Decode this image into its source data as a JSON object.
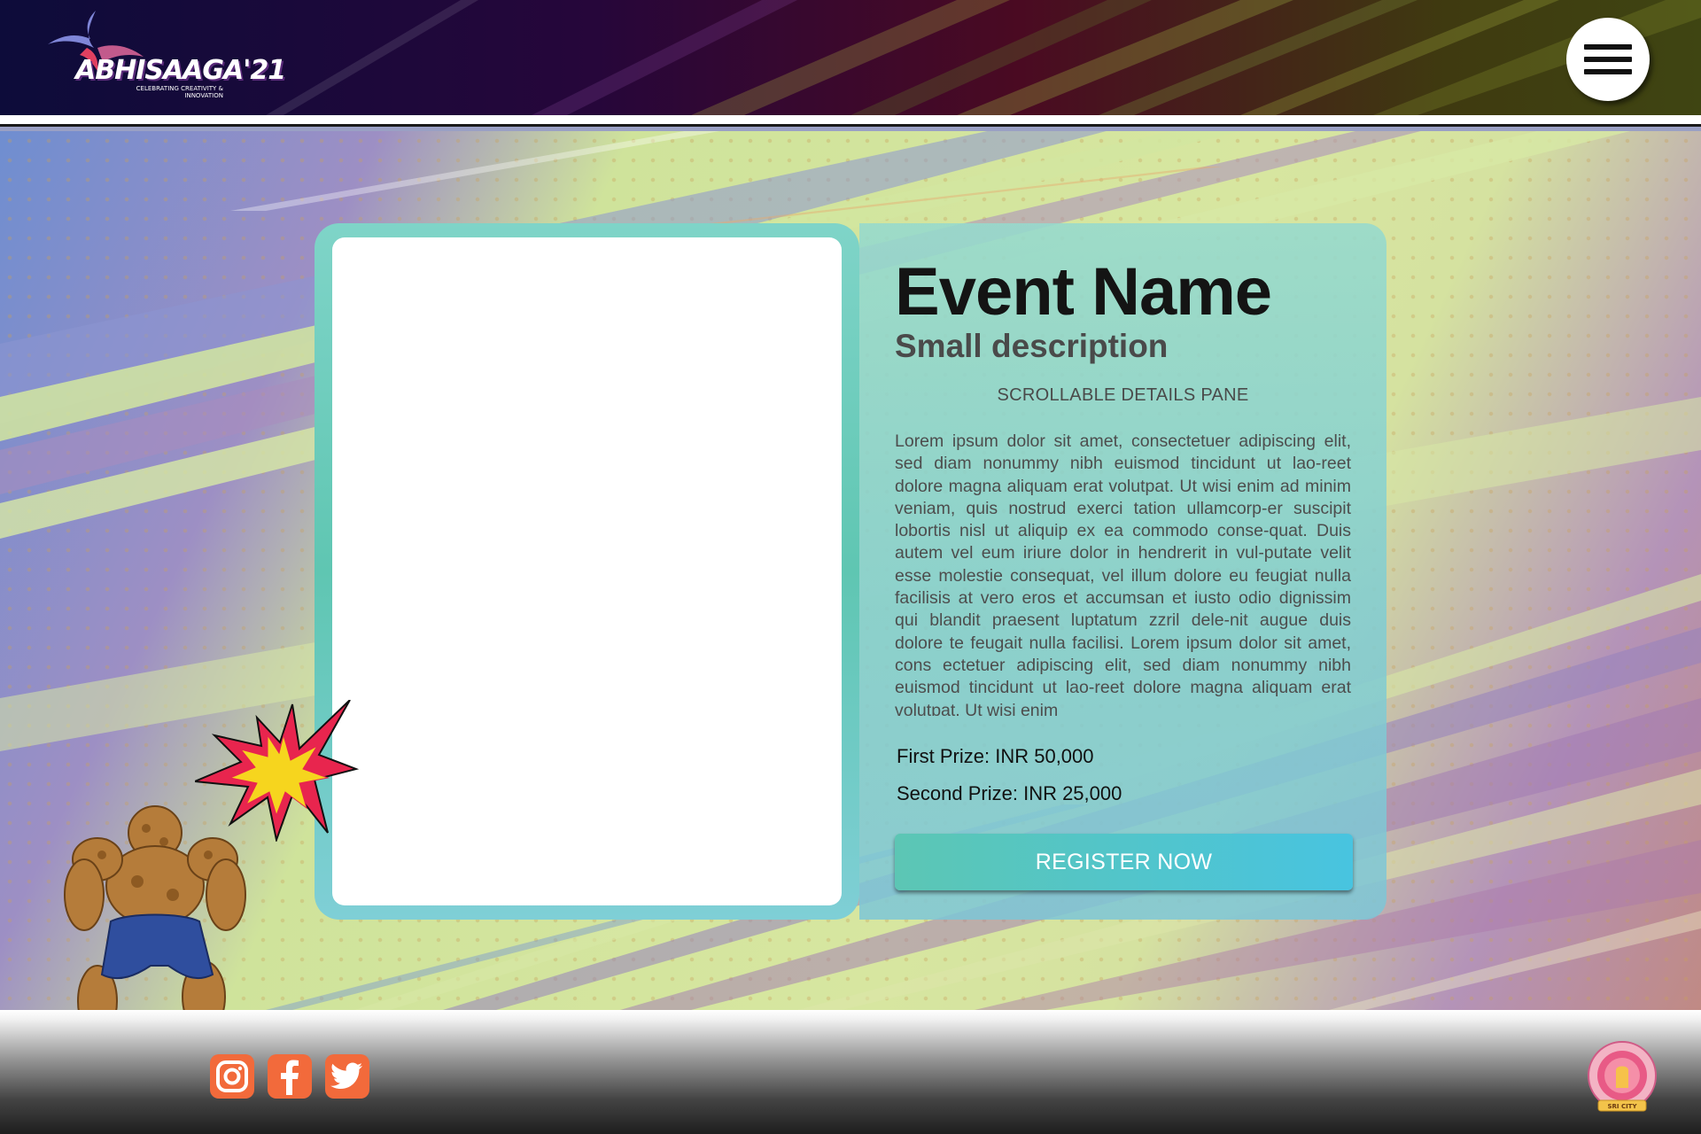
{
  "header": {
    "logo": {
      "text": "ABHISAAGA'21",
      "tagline": "CELEBRATING CREATIVITY & INNOVATION"
    },
    "menu_icon": "hamburger-menu-icon"
  },
  "event": {
    "name": "Event Name",
    "description": "Small description",
    "pane_label": "SCROLLABLE DETAILS  PANE",
    "details": "Lorem ipsum dolor sit amet, consectetuer adipiscing elit, sed diam nonummy nibh euismod tincidunt ut lao-reet dolore magna aliquam erat volutpat. Ut wisi enim ad minim veniam, quis nostrud exerci tation ullamcorp-er suscipit lobortis nisl ut aliquip ex ea commodo conse-quat. Duis autem vel eum iriure dolor in hendrerit in vul-putate velit esse molestie consequat, vel illum dolore eu feugiat nulla facilisis at vero eros et accumsan et iusto odio dignissim qui blandit praesent luptatum zzril dele-nit augue duis dolore te feugait nulla facilisi. Lorem ipsum dolor sit amet, cons ectetuer adipiscing elit, sed diam nonummy nibh euismod tincidunt ut lao-reet dolore magna aliquam erat volutpat. Ut wisi enim",
    "first_prize": "First Prize: INR 50,000",
    "second_prize": "Second Prize: INR 25,000",
    "register_label": "REGISTER NOW"
  },
  "footer": {
    "social": [
      "instagram-icon",
      "facebook-icon",
      "twitter-icon"
    ],
    "college_logo": {
      "text": "SRI CITY"
    }
  },
  "colors": {
    "accent_teal": "#5cc6b4",
    "accent_blue": "#48c4e0",
    "social_orange": "#f26a3b",
    "header_dark": "#0d0c3a"
  }
}
